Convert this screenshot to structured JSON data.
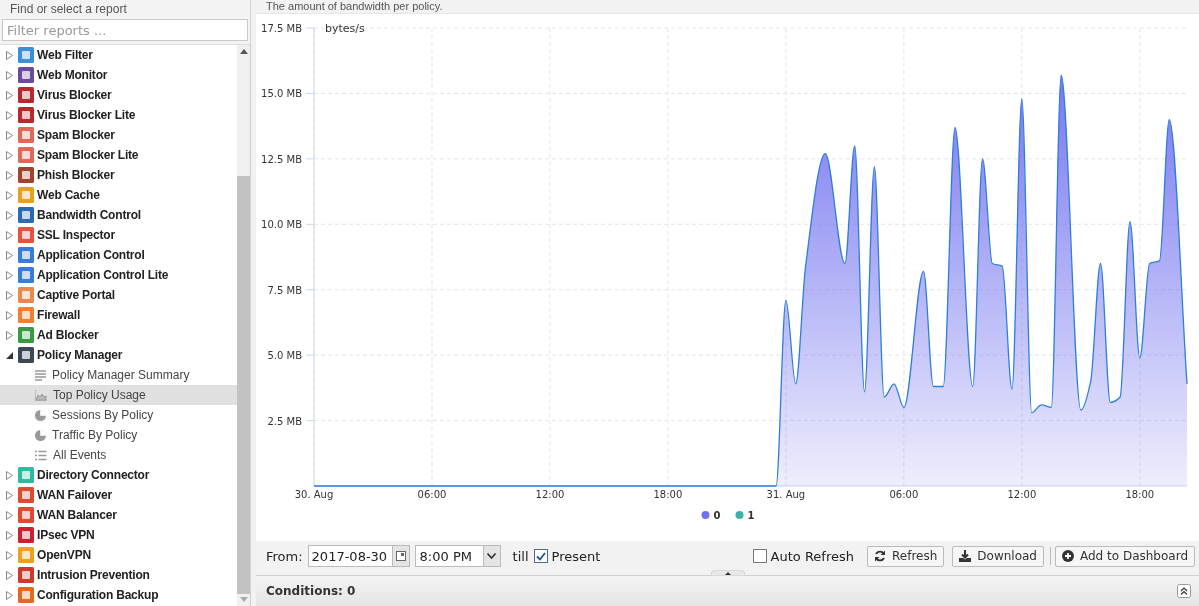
{
  "sidebar": {
    "title": "Find or select a report",
    "filter": {
      "placeholder": "Filter reports ..."
    },
    "items": [
      {
        "label": "Web Filter",
        "expanded": false,
        "selected": false
      },
      {
        "label": "Web Monitor",
        "expanded": false,
        "selected": false
      },
      {
        "label": "Virus Blocker",
        "expanded": false,
        "selected": false
      },
      {
        "label": "Virus Blocker Lite",
        "expanded": false,
        "selected": false
      },
      {
        "label": "Spam Blocker",
        "expanded": false,
        "selected": false
      },
      {
        "label": "Spam Blocker Lite",
        "expanded": false,
        "selected": false
      },
      {
        "label": "Phish Blocker",
        "expanded": false,
        "selected": false
      },
      {
        "label": "Web Cache",
        "expanded": false,
        "selected": false
      },
      {
        "label": "Bandwidth Control",
        "expanded": false,
        "selected": false
      },
      {
        "label": "SSL Inspector",
        "expanded": false,
        "selected": false
      },
      {
        "label": "Application Control",
        "expanded": false,
        "selected": false
      },
      {
        "label": "Application Control Lite",
        "expanded": false,
        "selected": false
      },
      {
        "label": "Captive Portal",
        "expanded": false,
        "selected": false
      },
      {
        "label": "Firewall",
        "expanded": false,
        "selected": false
      },
      {
        "label": "Ad Blocker",
        "expanded": false,
        "selected": false
      },
      {
        "label": "Policy Manager",
        "expanded": true,
        "selected": false,
        "children": [
          {
            "label": "Policy Manager Summary",
            "kind": "summary",
            "selected": false
          },
          {
            "label": "Top Policy Usage",
            "kind": "area",
            "selected": true
          },
          {
            "label": "Sessions By Policy",
            "kind": "pie",
            "selected": false
          },
          {
            "label": "Traffic By Policy",
            "kind": "pie",
            "selected": false
          },
          {
            "label": "All Events",
            "kind": "list",
            "selected": false
          }
        ]
      },
      {
        "label": "Directory Connector",
        "expanded": false,
        "selected": false
      },
      {
        "label": "WAN Failover",
        "expanded": false,
        "selected": false
      },
      {
        "label": "WAN Balancer",
        "expanded": false,
        "selected": false
      },
      {
        "label": "IPsec VPN",
        "expanded": false,
        "selected": false
      },
      {
        "label": "OpenVPN",
        "expanded": false,
        "selected": false
      },
      {
        "label": "Intrusion Prevention",
        "expanded": false,
        "selected": false
      },
      {
        "label": "Configuration Backup",
        "expanded": false,
        "selected": false
      }
    ]
  },
  "report": {
    "description": "The amount of bandwidth per policy.",
    "chart_data": {
      "type": "area",
      "grid": true,
      "ylabel": "bytes/s",
      "xlim": [
        "2017-08-30 00:00",
        "2017-08-31 20:24"
      ],
      "ylim": [
        0,
        17.5
      ],
      "xticks": [
        {
          "value": "2017-08-30 00:00",
          "label": "30. Aug"
        },
        {
          "value": "2017-08-30 06:00",
          "label": "06:00"
        },
        {
          "value": "2017-08-30 12:00",
          "label": "12:00"
        },
        {
          "value": "2017-08-30 18:00",
          "label": "18:00"
        },
        {
          "value": "2017-08-31 00:00",
          "label": "31. Aug"
        },
        {
          "value": "2017-08-31 06:00",
          "label": "06:00"
        },
        {
          "value": "2017-08-31 12:00",
          "label": "12:00"
        },
        {
          "value": "2017-08-31 18:00",
          "label": "18:00"
        }
      ],
      "yticks": [
        {
          "value": 2.5,
          "label": "2.5 MB"
        },
        {
          "value": 5,
          "label": "5.0 MB"
        },
        {
          "value": 7.5,
          "label": "7.5 MB"
        },
        {
          "value": 10,
          "label": "10.0 MB"
        },
        {
          "value": 12.5,
          "label": "12.5 MB"
        },
        {
          "value": 15,
          "label": "15.0 MB"
        },
        {
          "value": 17.5,
          "label": "17.5 MB"
        }
      ],
      "x": [
        "2017-08-30 00:00",
        "2017-08-30 23:30",
        "2017-08-31 00:00",
        "2017-08-31 00:30",
        "2017-08-31 01:00",
        "2017-08-31 02:00",
        "2017-08-31 03:00",
        "2017-08-31 03:30",
        "2017-08-31 04:00",
        "2017-08-31 04:30",
        "2017-08-31 05:00",
        "2017-08-31 05:30",
        "2017-08-31 06:00",
        "2017-08-31 07:00",
        "2017-08-31 07:30",
        "2017-08-31 08:00",
        "2017-08-31 08:36",
        "2017-08-31 09:30",
        "2017-08-31 10:00",
        "2017-08-31 10:30",
        "2017-08-31 11:00",
        "2017-08-31 11:30",
        "2017-08-31 12:00",
        "2017-08-31 12:30",
        "2017-08-31 13:00",
        "2017-08-31 13:30",
        "2017-08-31 14:00",
        "2017-08-31 15:00",
        "2017-08-31 15:30",
        "2017-08-31 16:00",
        "2017-08-31 16:30",
        "2017-08-31 17:00",
        "2017-08-31 17:30",
        "2017-08-31 18:00",
        "2017-08-31 18:30",
        "2017-08-31 19:00",
        "2017-08-31 19:30",
        "2017-08-31 20:24"
      ],
      "series": [
        {
          "name": "0",
          "color": "#7070f0",
          "values": [
            0,
            0,
            7.1,
            3.9,
            8.4,
            12.7,
            8.5,
            13.0,
            3.6,
            12.2,
            3.4,
            3.9,
            3.0,
            8.2,
            3.8,
            3.8,
            13.7,
            3.8,
            12.5,
            8.5,
            8.4,
            3.7,
            14.8,
            2.8,
            3.1,
            3.0,
            15.7,
            2.9,
            4.0,
            8.5,
            3.2,
            3.4,
            10.1,
            4.9,
            8.5,
            8.6,
            14.0,
            3.9
          ]
        },
        {
          "name": "1",
          "color": "#3cb0a8",
          "values": [
            null,
            null,
            null,
            null,
            null,
            null,
            null,
            null,
            null,
            null,
            null,
            null,
            null,
            null,
            null,
            null,
            null,
            null,
            null,
            null,
            null,
            null,
            null,
            null,
            null,
            null,
            null,
            null,
            null,
            null,
            null,
            null,
            null,
            null,
            null,
            null,
            null,
            null
          ]
        }
      ]
    }
  },
  "toolbar": {
    "from_label": "From:",
    "date": "2017-08-30",
    "time": "8:00 PM",
    "till_label": "till",
    "present": {
      "label": "Present",
      "checked": true
    },
    "auto_refresh": {
      "label": "Auto Refresh",
      "checked": false
    },
    "buttons": [
      {
        "label": "Refresh",
        "kind": "refresh"
      },
      {
        "label": "Download",
        "kind": "download"
      },
      {
        "label": "Add to Dashboard",
        "kind": "add"
      }
    ]
  },
  "conditions": {
    "title": "Conditions: 0"
  }
}
